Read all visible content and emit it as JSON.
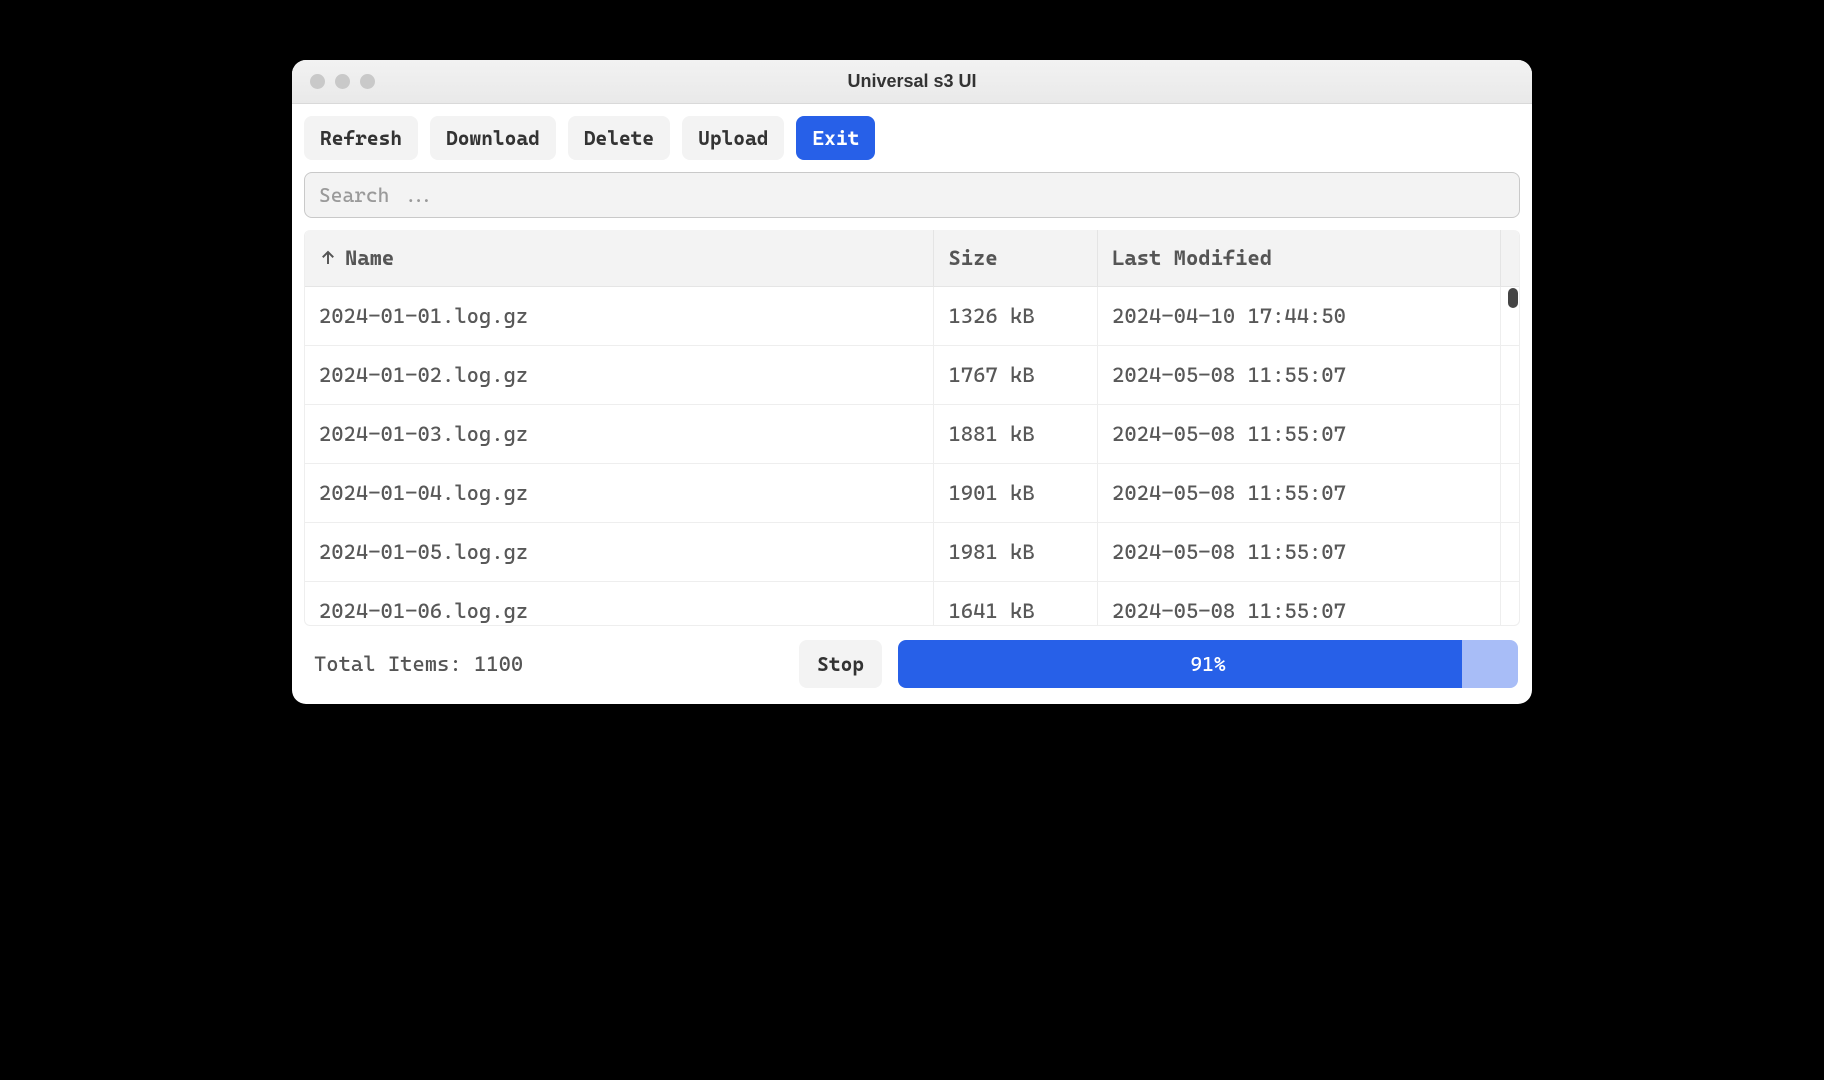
{
  "window": {
    "title": "Universal s3 UI"
  },
  "toolbar": {
    "refresh": "Refresh",
    "download": "Download",
    "delete": "Delete",
    "upload": "Upload",
    "exit": "Exit"
  },
  "search": {
    "placeholder": "Search ..."
  },
  "table": {
    "columns": {
      "name": "Name",
      "size": "Size",
      "modified": "Last Modified"
    },
    "sort": {
      "column": "name",
      "direction": "asc"
    },
    "rows": [
      {
        "name": "2024-01-01.log.gz",
        "size": "1326 kB",
        "modified": "2024-04-10 17:44:50"
      },
      {
        "name": "2024-01-02.log.gz",
        "size": "1767 kB",
        "modified": "2024-05-08 11:55:07"
      },
      {
        "name": "2024-01-03.log.gz",
        "size": "1881 kB",
        "modified": "2024-05-08 11:55:07"
      },
      {
        "name": "2024-01-04.log.gz",
        "size": "1901 kB",
        "modified": "2024-05-08 11:55:07"
      },
      {
        "name": "2024-01-05.log.gz",
        "size": "1981 kB",
        "modified": "2024-05-08 11:55:07"
      },
      {
        "name": "2024-01-06.log.gz",
        "size": "1641 kB",
        "modified": "2024-05-08 11:55:07"
      }
    ]
  },
  "footer": {
    "total_label": "Total Items: ",
    "total_count": "1100",
    "stop": "Stop",
    "progress_percent": 91,
    "progress_label": "91%"
  }
}
